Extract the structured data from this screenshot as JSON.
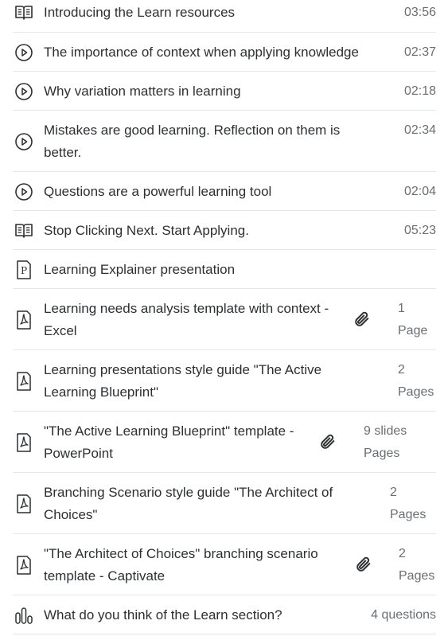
{
  "items": [
    {
      "icon": "book-icon",
      "title": "Introducing the Learn resources",
      "duration": "03:56"
    },
    {
      "icon": "play-circle-icon",
      "title": "The importance of context when applying knowledge",
      "duration": "02:37"
    },
    {
      "icon": "play-circle-icon",
      "title": "Why variation matters in learning",
      "duration": "02:18"
    },
    {
      "icon": "play-circle-icon",
      "title_line1": "Mistakes are good learning. Reflection on them is",
      "title_line2": "better.",
      "duration": "02:34"
    },
    {
      "icon": "play-circle-icon",
      "title": "Questions are a powerful learning tool",
      "duration": "02:04"
    },
    {
      "icon": "book-icon",
      "title": "Stop Clicking Next. Start Applying.",
      "duration": "05:23"
    },
    {
      "icon": "presentation-p-icon",
      "title": "Learning Explainer presentation"
    },
    {
      "icon": "pdf-icon",
      "title_line1": "Learning needs analysis template with context -",
      "title_line2": "Excel",
      "has_attachment": true,
      "meta_line1": "1",
      "meta_line2": "Page"
    },
    {
      "icon": "pdf-icon",
      "title_line1": "Learning presentations style guide \"The Active",
      "title_line2": "Learning Blueprint\"",
      "meta_line1": "2",
      "meta_line2": "Pages"
    },
    {
      "icon": "pdf-icon",
      "title_line1": "\"The Active Learning Blueprint\" template -",
      "title_line2": "PowerPoint",
      "has_attachment": true,
      "meta_line1": "9 slides",
      "meta_line2": "Pages"
    },
    {
      "icon": "pdf-icon",
      "title_line1": "Branching Scenario style guide \"The Architect of",
      "title_line2": "Choices\"",
      "meta_line1": "2",
      "meta_line2": "Pages"
    },
    {
      "icon": "pdf-icon",
      "title_line1": "\"The Architect of Choices\" branching scenario",
      "title_line2": "template - Captivate",
      "has_attachment": true,
      "meta_line1": "2",
      "meta_line2": "Pages"
    },
    {
      "icon": "bar-chart-icon",
      "title": "What do you think of the Learn section?",
      "duration": "4 questions"
    }
  ]
}
